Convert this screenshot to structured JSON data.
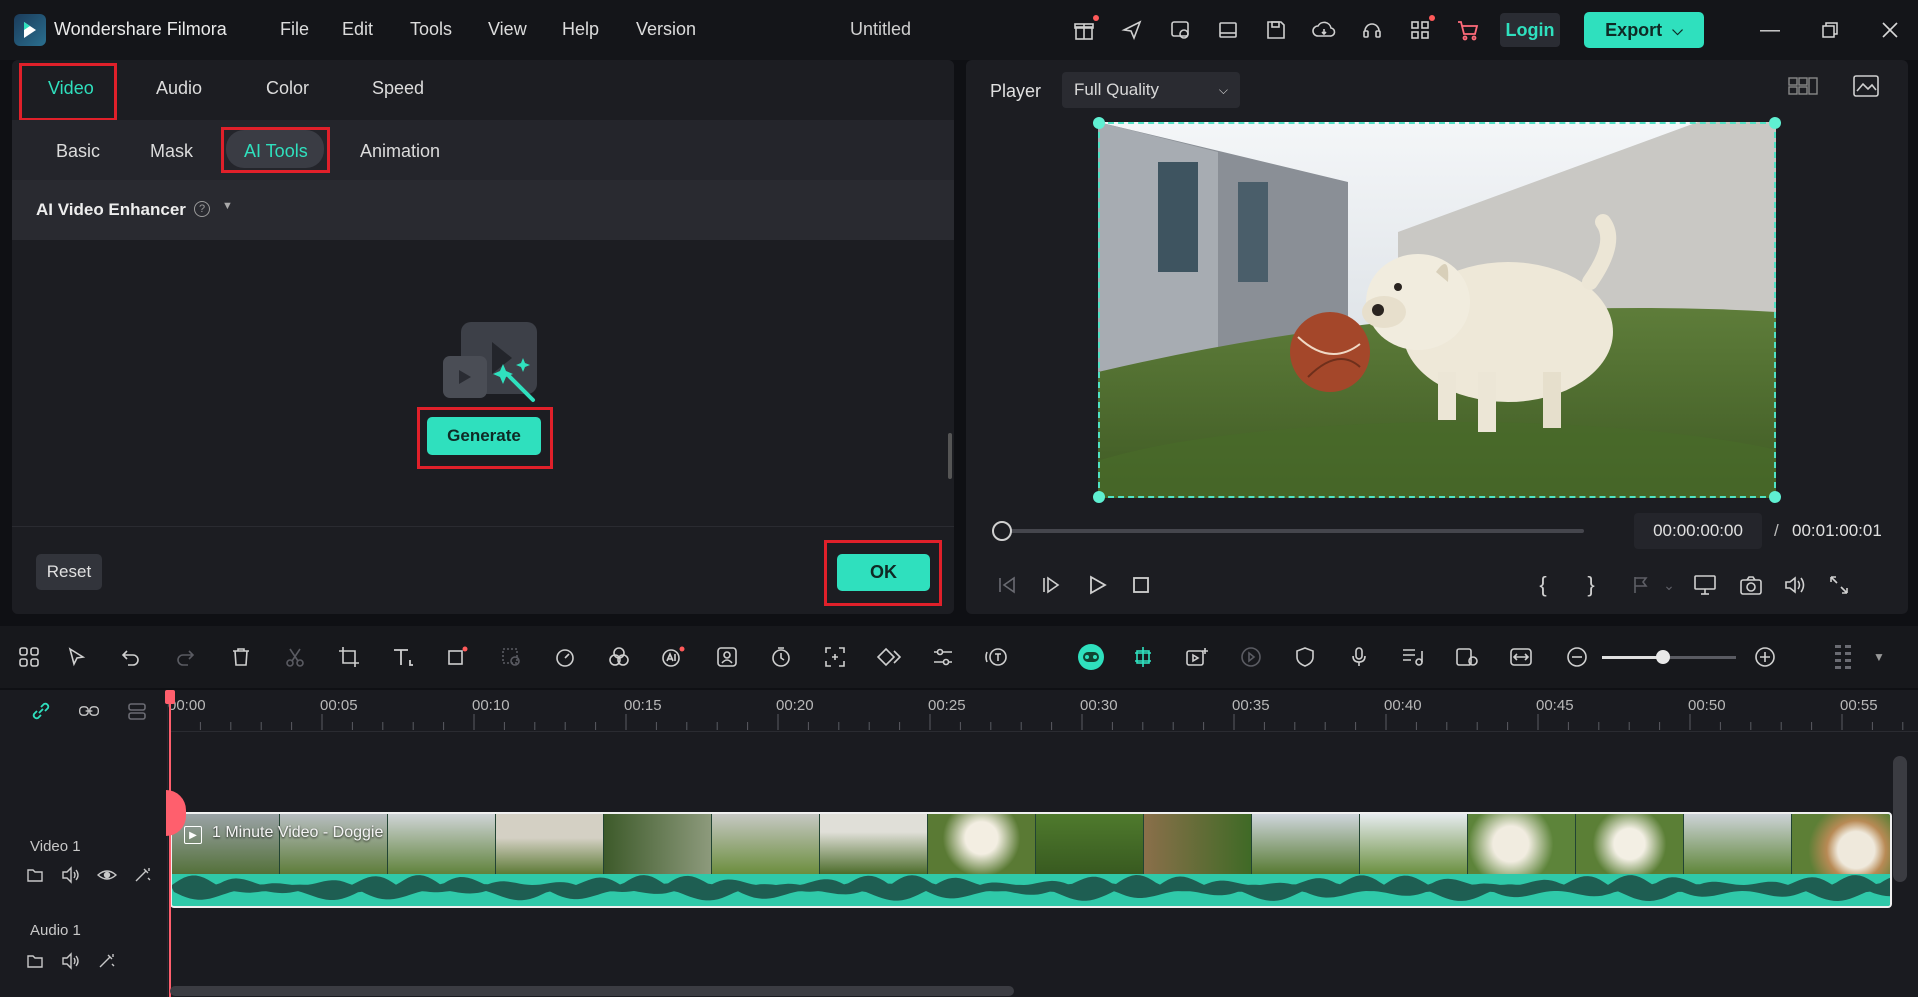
{
  "app": {
    "title": "Wondershare Filmora",
    "document_title": "Untitled",
    "menu": [
      "File",
      "Edit",
      "Tools",
      "View",
      "Help",
      "Version"
    ],
    "login_label": "Login",
    "export_label": "Export",
    "accent_color": "#2fe0be",
    "highlight_color": "#e0202a"
  },
  "left_panel": {
    "tabs": [
      "Video",
      "Audio",
      "Color",
      "Speed"
    ],
    "active_tab": "Video",
    "subtabs": [
      "Basic",
      "Mask",
      "AI Tools",
      "Animation"
    ],
    "active_subtab": "AI Tools",
    "section_title": "AI Video Enhancer",
    "generate_label": "Generate",
    "reset_label": "Reset",
    "ok_label": "OK"
  },
  "player": {
    "label": "Player",
    "quality": "Full Quality",
    "current_time": "00:00:00:00",
    "separator": "/",
    "total_time": "00:01:00:01"
  },
  "timeline": {
    "ruler": [
      "00:00",
      "00:05",
      "00:10",
      "00:15",
      "00:20",
      "00:25",
      "00:30",
      "00:35",
      "00:40",
      "00:45",
      "00:50",
      "00:55"
    ],
    "video_track": "Video 1",
    "audio_track": "Audio 1",
    "clip_title": "1 Minute Video - Doggie"
  },
  "icons": {
    "toolbar_top": [
      "gift-icon",
      "send-icon",
      "media-icon",
      "layout-icon",
      "save-icon",
      "cloud-icon",
      "support-icon",
      "apps-icon",
      "cart-icon"
    ],
    "window": [
      "minimize-icon",
      "restore-icon",
      "close-icon"
    ]
  }
}
